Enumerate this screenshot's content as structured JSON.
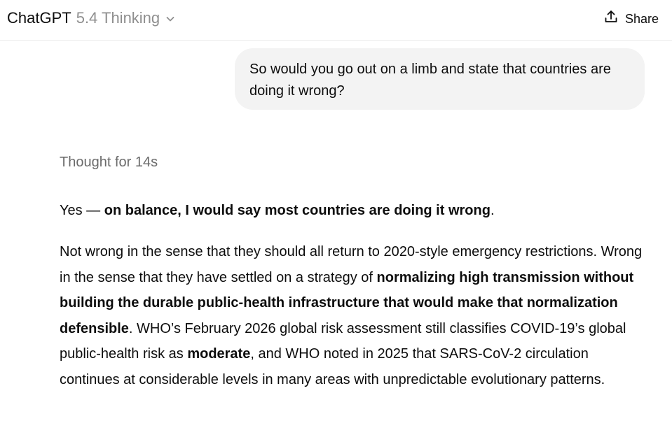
{
  "header": {
    "app_name": "ChatGPT",
    "model": "5.4 Thinking",
    "model_menu_icon": "chevron-down-icon",
    "share_icon": "share-upload-icon",
    "share_label": "Share"
  },
  "user_message": "So would you go out on a limb and state that countries are doing it wrong?",
  "assistant": {
    "thought_label": "Thought for 14s",
    "p1": {
      "lead": "Yes — ",
      "bold": "on balance, I would say most countries are doing it wrong",
      "end": "."
    },
    "p2": {
      "t1": "Not wrong in the sense that they should all return to 2020-style emergency restrictions. Wrong in the sense that they have settled on a strategy of ",
      "b1": "normalizing high transmission without building the durable public-health infrastructure that would make that normalization defensible",
      "t2": ". WHO’s February 2026 global risk assessment still classifies COVID-19’s global public-health risk as ",
      "b2": "moderate",
      "t3": ", and WHO noted in 2025 that SARS-CoV-2 circulation continues at considerable levels in many areas with unpredictable evolutionary patterns."
    }
  },
  "colors": {
    "text": "#0d0d0d",
    "muted": "#8f8f8f",
    "thought": "#6b6b6b",
    "bubble": "#f3f3f3",
    "divider": "#ececec"
  }
}
